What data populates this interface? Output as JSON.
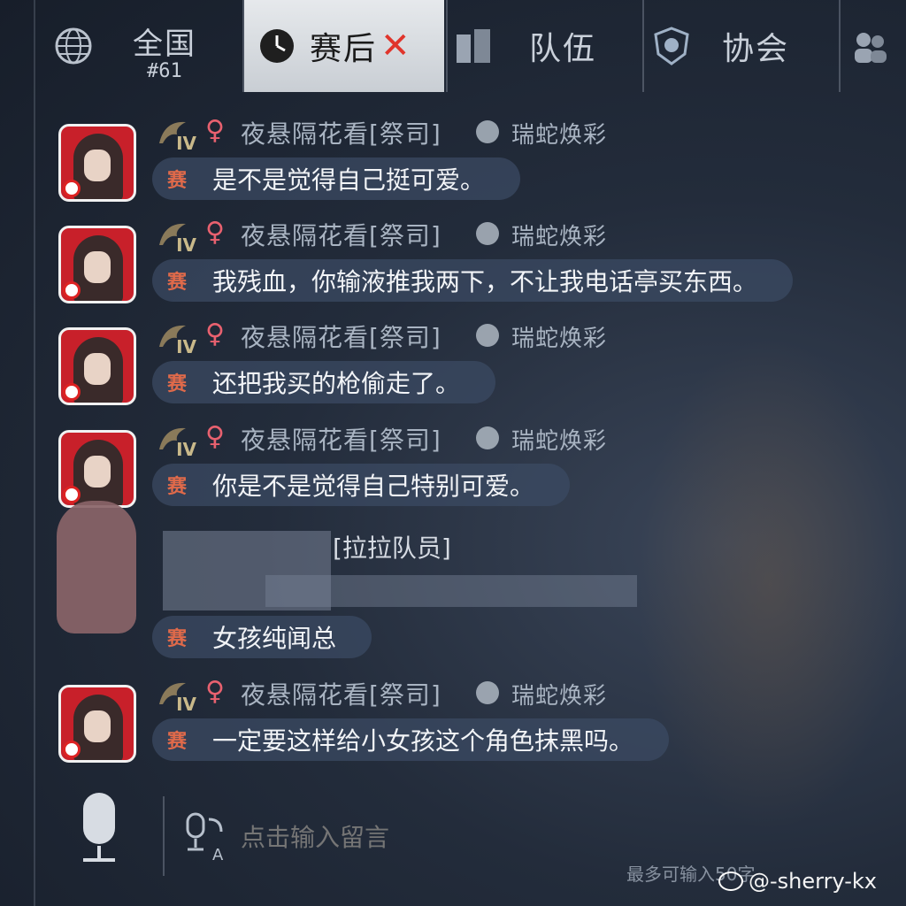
{
  "tabs": {
    "national": {
      "label": "全国",
      "rank": "#61"
    },
    "postmatch": {
      "label": "赛后",
      "close": "✕"
    },
    "team": {
      "label": "队伍"
    },
    "guild": {
      "label": "协会"
    }
  },
  "messages": [
    {
      "tier": "IV",
      "gender": "♀",
      "username": "夜悬隔花看[祭司]",
      "title": "瑞蛇焕彩",
      "tag": "赛",
      "text": "是不是觉得自己挺可爱。"
    },
    {
      "tier": "IV",
      "gender": "♀",
      "username": "夜悬隔花看[祭司]",
      "title": "瑞蛇焕彩",
      "tag": "赛",
      "text": "我残血，你输液推我两下，不让我电话亭买东西。"
    },
    {
      "tier": "IV",
      "gender": "♀",
      "username": "夜悬隔花看[祭司]",
      "title": "瑞蛇焕彩",
      "tag": "赛",
      "text": "还把我买的枪偷走了。"
    },
    {
      "tier": "IV",
      "gender": "♀",
      "username": "夜悬隔花看[祭司]",
      "title": "瑞蛇焕彩",
      "tag": "赛",
      "text": "你是不是觉得自己特别可爱。"
    }
  ],
  "obscured_message": {
    "username_suffix": "[拉拉队员]",
    "tag": "赛",
    "text": "女孩纯闻总"
  },
  "last_message": {
    "tier": "IV",
    "gender": "♀",
    "username": "夜悬隔花看[祭司]",
    "title": "瑞蛇焕彩",
    "tag": "赛",
    "text": "一定要这样给小女孩这个角色抹黑吗。"
  },
  "input": {
    "placeholder": "点击输入留言",
    "limit_note": "最多可输入50字"
  },
  "watermark": "@-sherry-kx"
}
